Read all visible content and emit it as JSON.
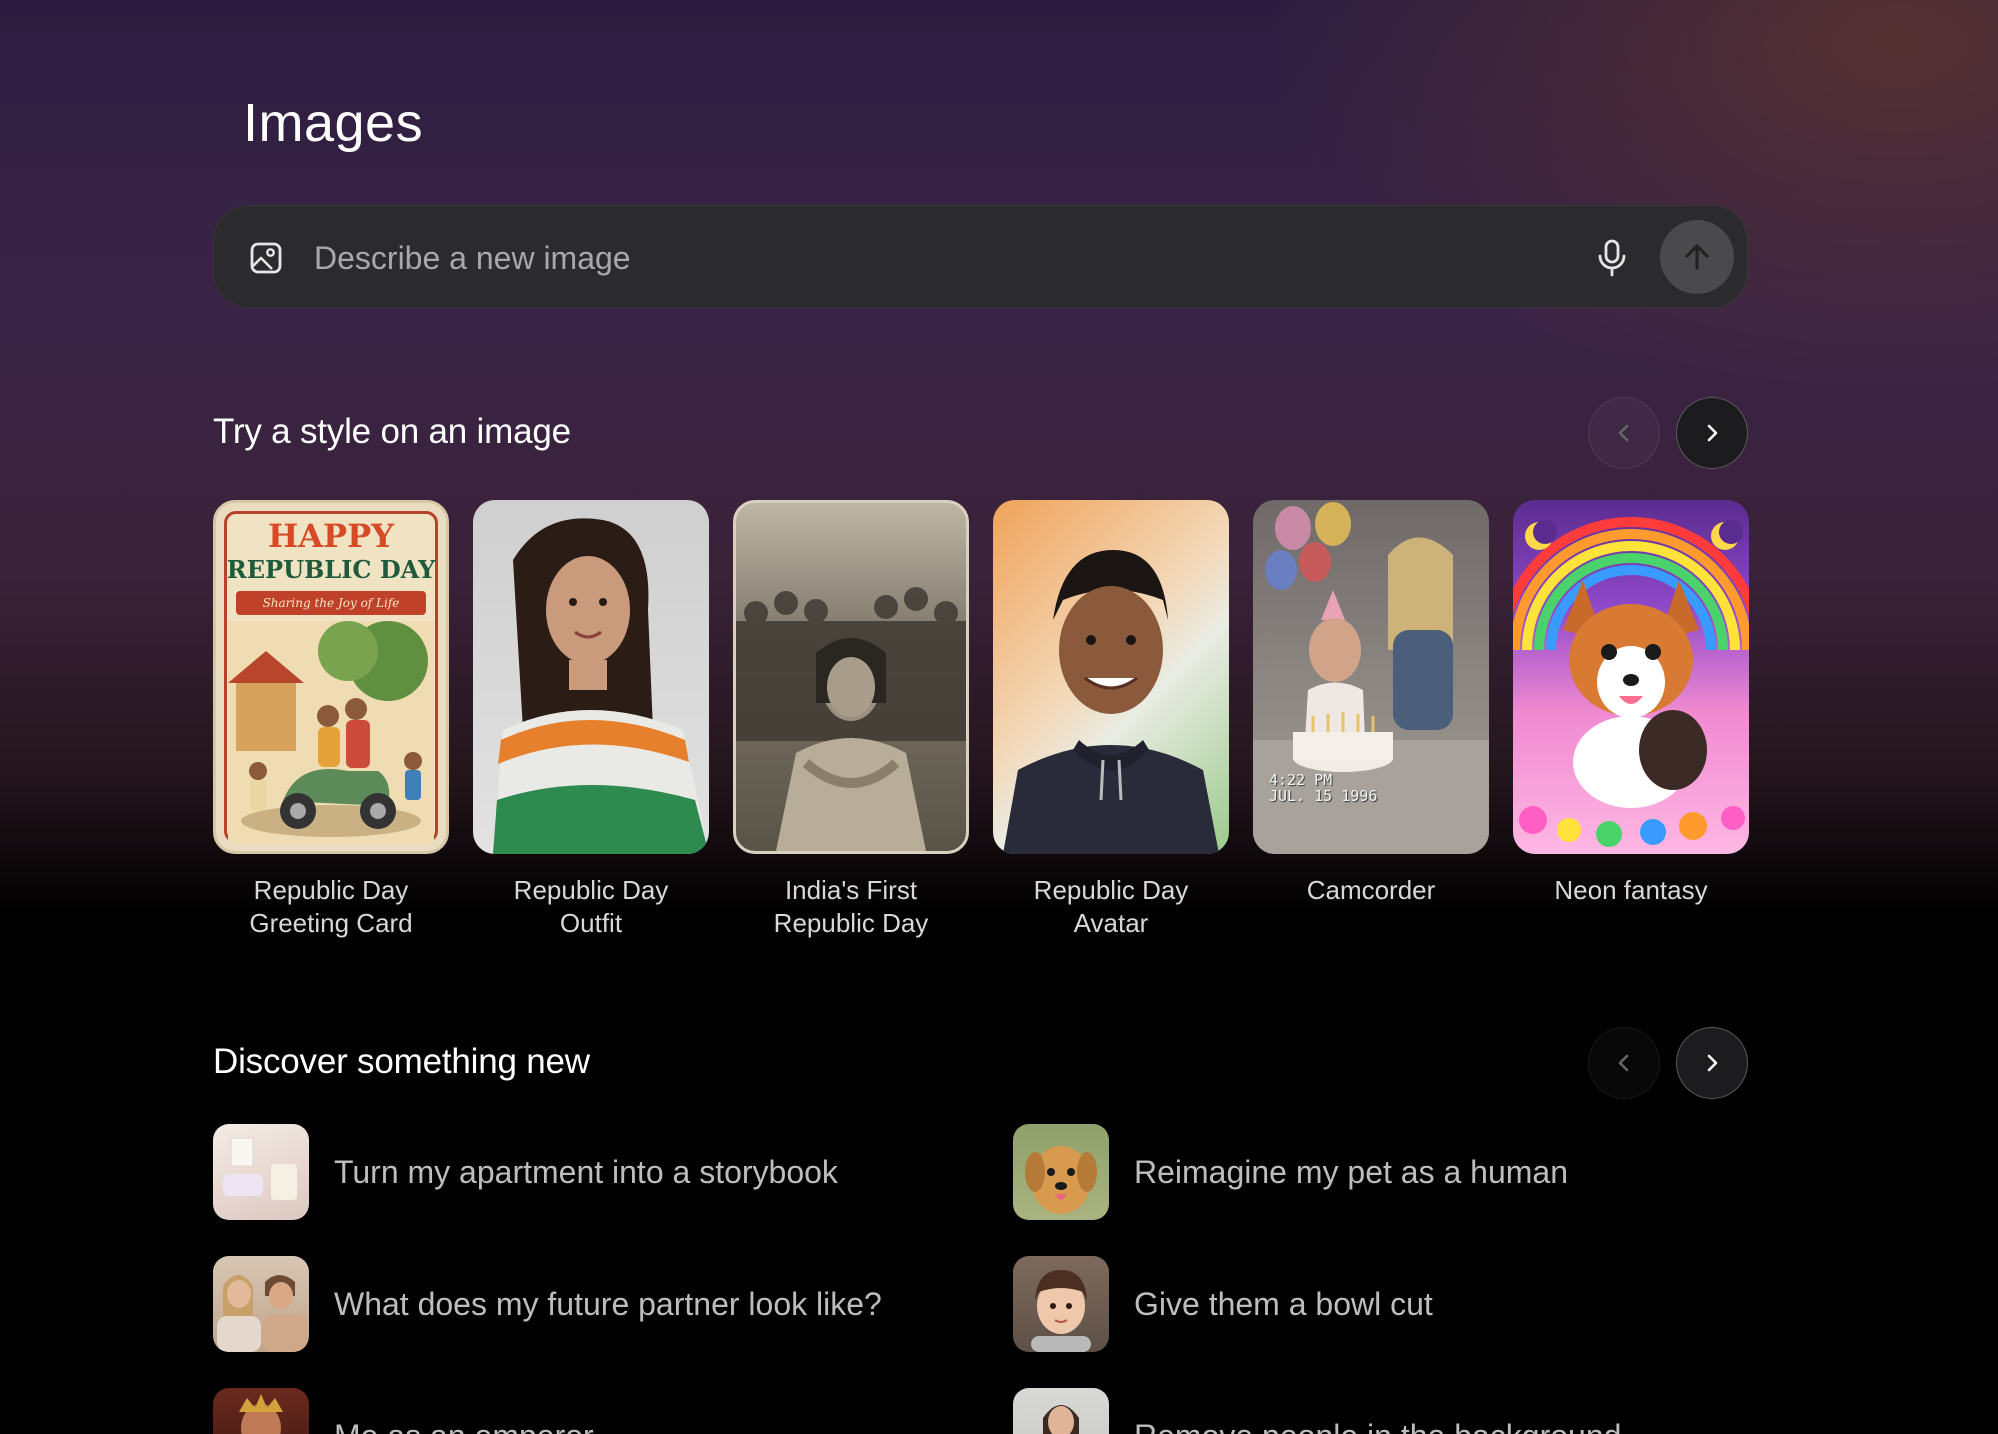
{
  "header": {
    "title": "Images"
  },
  "search": {
    "placeholder": "Describe a new image"
  },
  "icons": {
    "image": "image-icon",
    "mic": "microphone-icon",
    "send": "arrow-up-icon",
    "prev": "chevron-left-icon",
    "next": "chevron-right-icon"
  },
  "styles_section": {
    "title": "Try a style on an image",
    "items": [
      {
        "label": "Republic Day Greeting Card",
        "label_line1": "Republic Day",
        "label_line2": "Greeting Card",
        "card_text": "HAPPY",
        "card_text2": "REPUBLIC DAY",
        "card_text3": "Sharing the Joy of Life"
      },
      {
        "label": "Republic Day Outfit",
        "label_line1": "Republic Day",
        "label_line2": "Outfit"
      },
      {
        "label": "India's First Republic Day",
        "label_line1": "India's First",
        "label_line2": "Republic Day"
      },
      {
        "label": "Republic Day Avatar",
        "label_line1": "Republic Day",
        "label_line2": "Avatar"
      },
      {
        "label": "Camcorder",
        "label_line1": "Camcorder",
        "label_line2": "",
        "stamp_time": "4:22 PM",
        "stamp_date": "JUL. 15 1996"
      },
      {
        "label": "Neon fantasy",
        "label_line1": "Neon fantasy",
        "label_line2": ""
      }
    ]
  },
  "discover_section": {
    "title": "Discover something new",
    "items": [
      {
        "label": "Turn my apartment into a storybook"
      },
      {
        "label": "Reimagine my pet as a human"
      },
      {
        "label": "What does my future partner look like?"
      },
      {
        "label": "Give them a bowl cut"
      },
      {
        "label": "Me as an emperor"
      },
      {
        "label": "Remove people in the background"
      }
    ]
  },
  "colors": {
    "background_top": "#2c1d40",
    "background_bottom": "#000000",
    "search_bar": "#2b2b2e",
    "send_button": "#4a4a4d",
    "label_text": "#d8d8d8"
  }
}
